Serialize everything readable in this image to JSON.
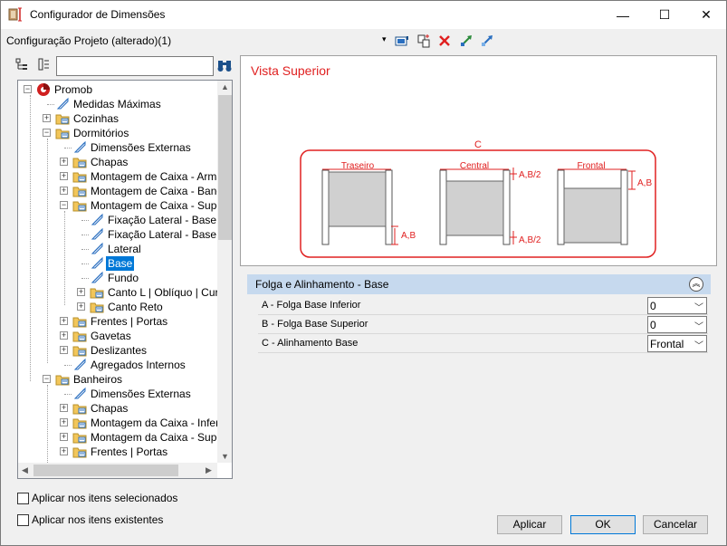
{
  "window": {
    "title": "Configurador de Dimensões",
    "minimize": "—",
    "maximize": "☐",
    "close": "✕"
  },
  "config": {
    "label": "Configuração Projeto (alterado)(1)",
    "dropdown_arrow": "▾"
  },
  "toolbar_icons": [
    "save-config-icon",
    "copy-config-icon",
    "delete-icon",
    "import-icon",
    "export-icon"
  ],
  "search": {
    "value": "",
    "placeholder": ""
  },
  "tree": {
    "nodes": [
      {
        "label": "Promob",
        "exp": "−"
      },
      {
        "label": "Medidas Máximas",
        "exp": ""
      },
      {
        "label": "Cozinhas",
        "exp": "+"
      },
      {
        "label": "Dormitórios",
        "exp": "−"
      },
      {
        "label": "Dimensões Externas",
        "exp": ""
      },
      {
        "label": "Chapas",
        "exp": "+"
      },
      {
        "label": "Montagem de Caixa - Armário",
        "exp": "+"
      },
      {
        "label": "Montagem de Caixa - Bancada",
        "exp": "+"
      },
      {
        "label": "Montagem de Caixa - Superior",
        "exp": "−"
      },
      {
        "label": "Fixação Lateral - Base Inferior",
        "exp": ""
      },
      {
        "label": "Fixação Lateral - Base Superior",
        "exp": ""
      },
      {
        "label": "Lateral",
        "exp": ""
      },
      {
        "label": "Base",
        "exp": ""
      },
      {
        "label": "Fundo",
        "exp": ""
      },
      {
        "label": "Canto L | Oblíquo | Curvo",
        "exp": "+"
      },
      {
        "label": "Canto Reto",
        "exp": "+"
      },
      {
        "label": "Frentes | Portas",
        "exp": "+"
      },
      {
        "label": "Gavetas",
        "exp": "+"
      },
      {
        "label": "Deslizantes",
        "exp": "+"
      },
      {
        "label": "Agregados Internos",
        "exp": ""
      },
      {
        "label": "Banheiros",
        "exp": "−"
      },
      {
        "label": "Dimensões Externas",
        "exp": ""
      },
      {
        "label": "Chapas",
        "exp": "+"
      },
      {
        "label": "Montagem da Caixa - Inferior",
        "exp": "+"
      },
      {
        "label": "Montagem da Caixa - Superior",
        "exp": "+"
      },
      {
        "label": "Frentes | Portas",
        "exp": "+"
      }
    ]
  },
  "checks": [
    {
      "label": "Aplicar nos itens selecionados",
      "checked": false
    },
    {
      "label": "Aplicar nos itens existentes",
      "checked": false
    }
  ],
  "preview": {
    "title": "Vista Superior",
    "c_label": "C",
    "cabinets": [
      "Traseiro",
      "Central",
      "Frontal"
    ],
    "dim_ab": "A,B",
    "dim_ab2": "A,B/2",
    "accent_color": "#e02020"
  },
  "section": {
    "title": "Folga e Alinhamento - Base",
    "collapse_symbol": "︽",
    "rows": [
      {
        "label": "A - Folga Base Inferior",
        "value": "0"
      },
      {
        "label": "B - Folga Base Superior",
        "value": "0"
      },
      {
        "label": "C - Alinhamento Base",
        "value": "Frontal"
      }
    ]
  },
  "buttons": {
    "apply": "Aplicar",
    "ok": "OK",
    "cancel": "Cancelar"
  }
}
